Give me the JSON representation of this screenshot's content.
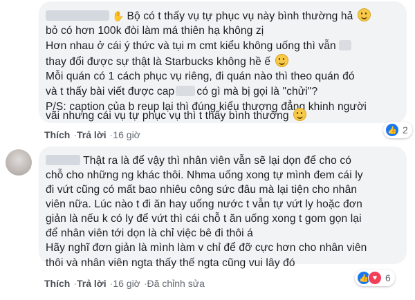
{
  "comments": [
    {
      "line1_text": "Bộ có t thấy vụ tự phục vụ này bình thường hả",
      "lines": [
        "bỏ có hơn 100k đòi làm má thiên hạ không zị",
        "Hơn nhau ở cái ý thức và tụi m cmt kiểu không uống thì vẫn",
        "thay đổi được sự thật là Starbucks không hề ế",
        "Mỗi quán có 1 cách phục vụ riêng, đi quán nào thì theo quán đó",
        "và t thấy bài viết được cap",
        "P/S: caption của b reup lại thì đúng kiểu thượng đẳng khinh người",
        "vãi nhưng cái vụ tự phục vụ thì t thấy bình thường"
      ],
      "line6_tail": "có gì mà bị gọi là \"chửi\"?",
      "actions": {
        "like": "Thích",
        "reply": "Trả lời",
        "time": "16 giờ"
      },
      "reaction_count": "2"
    },
    {
      "lines": [
        "Thật ra là để vậy thì nhân viên vẫn sẽ lại dọn để cho có",
        "chỗ cho những ng khác thôi. Nhma uống xong tự mình đem cái ly",
        "đi vứt cũng có mất bao nhiêu công sức đâu mà lại tiện cho nhân",
        "viên nữa. Lúc nào t đi ăn hay uống nước t vẫn tự vứt ly hoặc đơn",
        "giản là nếu k có ly để vứt thì cái chỗ t ăn uống xong t gom gọn lại",
        "để nhân viên tới dọn là chỉ việc bê đi thôi á",
        "Hãy nghĩ đơn giản là mình làm v chỉ để đỡ cực hơn cho nhân viên",
        "thôi và nhân viên ngta thấy thế ngta cũng vui lây đó"
      ],
      "actions": {
        "like": "Thích",
        "reply": "Trả lời",
        "time": "16 giờ",
        "edited": "Đã chỉnh sửa"
      },
      "reaction_count": "6"
    }
  ],
  "icons": {
    "emoji": "smiley-emoji-icon",
    "like": "like-reaction-icon",
    "heart": "love-reaction-icon",
    "wave": "waving-hand-icon"
  },
  "colors": {
    "bubble": "#f2f3f5",
    "link": "#4b4f56",
    "like_blue": "#1877f2",
    "heart_red": "#f33e58"
  }
}
